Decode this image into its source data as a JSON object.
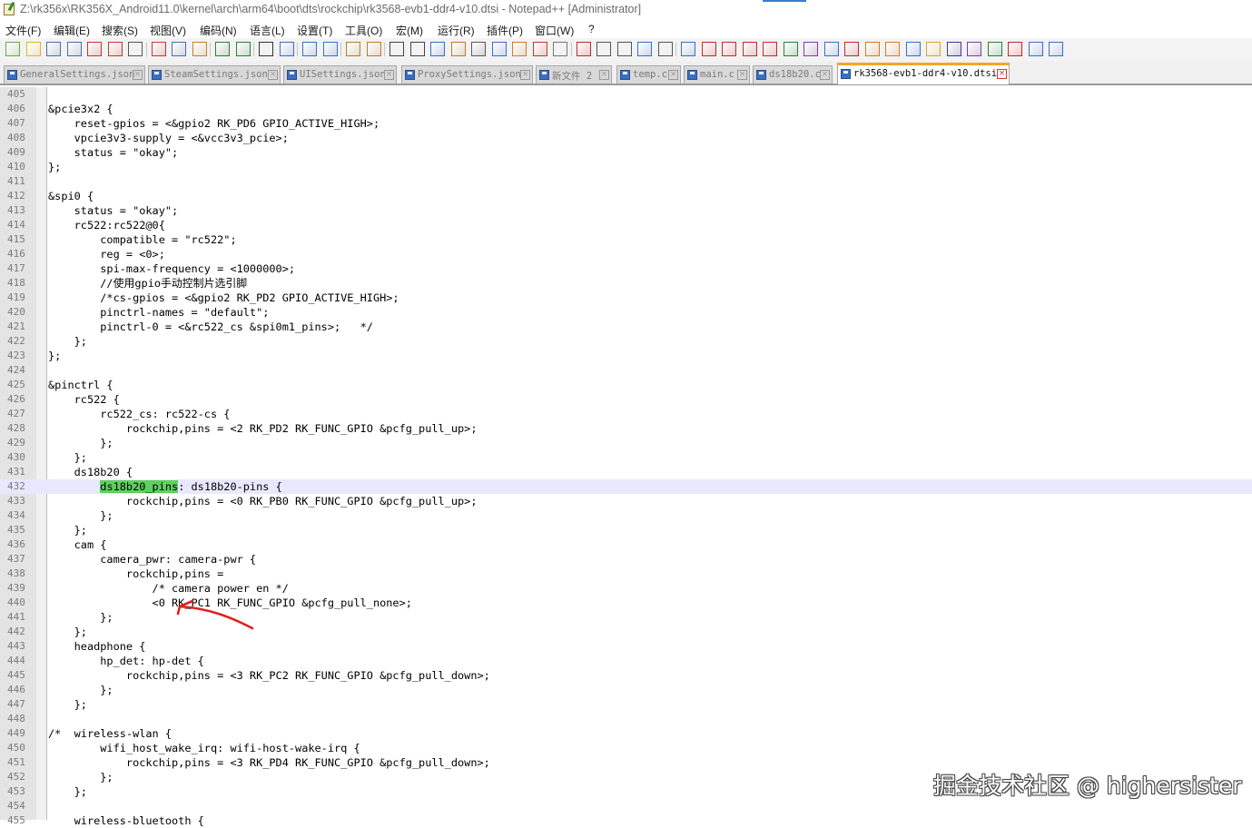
{
  "window": {
    "title": "Z:\\rk356x\\RK356X_Android11.0\\kernel\\arch\\arm64\\boot\\dts\\rockchip\\rk3568-evb1-ddr4-v10.dtsi - Notepad++ [Administrator]"
  },
  "menu": [
    "文件(F)",
    "编辑(E)",
    "搜索(S)",
    "视图(V)",
    "编码(N)",
    "语言(L)",
    "设置(T)",
    "工具(O)",
    "宏(M)",
    "运行(R)",
    "插件(P)",
    "窗口(W)",
    "?"
  ],
  "toolbar": {
    "icons": [
      "new-file-icon",
      "open-file-icon",
      "save-icon",
      "save-all-icon",
      "close-icon",
      "close-all-icon",
      "print-icon",
      "cut-icon",
      "copy-icon",
      "paste-icon",
      "undo-icon",
      "redo-icon",
      "find-icon",
      "replace-icon",
      "zoom-in-icon",
      "zoom-out-icon",
      "sync-vertical-icon",
      "sync-horizontal-icon",
      "word-wrap-icon",
      "show-all-chars-icon",
      "indent-guide-icon",
      "lang-udl-icon",
      "doc-map-icon",
      "doc-list-icon",
      "function-list-icon",
      "folder-workspace-icon",
      "monitoring-icon",
      "record-macro-icon",
      "stop-record-icon",
      "play-macro-icon",
      "run-macro-multiple-icon",
      "save-macro-icon",
      "prev-bookmark-icon",
      "jump-first-icon",
      "jump-prev-icon",
      "jump-next-icon",
      "jump-last-icon",
      "plugin-a-icon",
      "plugin-b-icon",
      "plugin-c-icon",
      "plugin-d-icon",
      "plugin-e-icon",
      "plugin-f-icon",
      "plugin-g-icon",
      "plugin-h-icon",
      "plugin-i-icon",
      "plugin-j-icon",
      "plugin-k-icon",
      "plugin-l-icon",
      "plugin-m-icon",
      "plugin-n-icon"
    ]
  },
  "tabs": [
    {
      "label": "GeneralSettings.json",
      "active": false
    },
    {
      "label": "SteamSettings.json",
      "active": false
    },
    {
      "label": "UISettings.json",
      "active": false
    },
    {
      "label": "ProxySettings.json",
      "active": false
    },
    {
      "label": "新文件 2",
      "active": false
    },
    {
      "label": "temp.c",
      "active": false
    },
    {
      "label": "main.c",
      "active": false
    },
    {
      "label": "ds18b20.c",
      "active": false
    },
    {
      "label": "rk3568-evb1-ddr4-v10.dtsi",
      "active": true
    }
  ],
  "editor": {
    "current_line": 432,
    "highlight_term": "ds18b20_pins",
    "lines": [
      {
        "n": "405",
        "text": ""
      },
      {
        "n": "406",
        "text": "&pcie3x2 {"
      },
      {
        "n": "407",
        "text": "    reset-gpios = <&gpio2 RK_PD6 GPIO_ACTIVE_HIGH>;"
      },
      {
        "n": "408",
        "text": "    vpcie3v3-supply = <&vcc3v3_pcie>;"
      },
      {
        "n": "409",
        "text": "    status = \"okay\";"
      },
      {
        "n": "410",
        "text": "};"
      },
      {
        "n": "411",
        "text": ""
      },
      {
        "n": "412",
        "text": "&spi0 {"
      },
      {
        "n": "413",
        "text": "    status = \"okay\";"
      },
      {
        "n": "414",
        "text": "    rc522:rc522@0{"
      },
      {
        "n": "415",
        "text": "        compatible = \"rc522\";"
      },
      {
        "n": "416",
        "text": "        reg = <0>;"
      },
      {
        "n": "417",
        "text": "        spi-max-frequency = <1000000>;"
      },
      {
        "n": "418",
        "text": "        //使用gpio手动控制片选引脚"
      },
      {
        "n": "419",
        "text": "        /*cs-gpios = <&gpio2 RK_PD2 GPIO_ACTIVE_HIGH>;"
      },
      {
        "n": "420",
        "text": "        pinctrl-names = \"default\";"
      },
      {
        "n": "421",
        "text": "        pinctrl-0 = <&rc522_cs &spi0m1_pins>;   */"
      },
      {
        "n": "422",
        "text": "    };"
      },
      {
        "n": "423",
        "text": "};"
      },
      {
        "n": "424",
        "text": ""
      },
      {
        "n": "425",
        "text": "&pinctrl {"
      },
      {
        "n": "426",
        "text": "    rc522 {"
      },
      {
        "n": "427",
        "text": "        rc522_cs: rc522-cs {"
      },
      {
        "n": "428",
        "text": "            rockchip,pins = <2 RK_PD2 RK_FUNC_GPIO &pcfg_pull_up>;"
      },
      {
        "n": "429",
        "text": "        };"
      },
      {
        "n": "430",
        "text": "    };"
      },
      {
        "n": "431",
        "text": "    ds18b20 {"
      },
      {
        "n": "432",
        "text": "        ds18b20_pins: ds18b20-pins {"
      },
      {
        "n": "433",
        "text": "            rockchip,pins = <0 RK_PB0 RK_FUNC_GPIO &pcfg_pull_up>;"
      },
      {
        "n": "434",
        "text": "        };"
      },
      {
        "n": "435",
        "text": "    };"
      },
      {
        "n": "436",
        "text": "    cam {"
      },
      {
        "n": "437",
        "text": "        camera_pwr: camera-pwr {"
      },
      {
        "n": "438",
        "text": "            rockchip,pins ="
      },
      {
        "n": "439",
        "text": "                /* camera power en */"
      },
      {
        "n": "440",
        "text": "                <0 RK_PC1 RK_FUNC_GPIO &pcfg_pull_none>;"
      },
      {
        "n": "441",
        "text": "        };"
      },
      {
        "n": "442",
        "text": "    };"
      },
      {
        "n": "443",
        "text": "    headphone {"
      },
      {
        "n": "444",
        "text": "        hp_det: hp-det {"
      },
      {
        "n": "445",
        "text": "            rockchip,pins = <3 RK_PC2 RK_FUNC_GPIO &pcfg_pull_down>;"
      },
      {
        "n": "446",
        "text": "        };"
      },
      {
        "n": "447",
        "text": "    };"
      },
      {
        "n": "448",
        "text": ""
      },
      {
        "n": "449",
        "text": "/*  wireless-wlan {"
      },
      {
        "n": "450",
        "text": "        wifi_host_wake_irq: wifi-host-wake-irq {"
      },
      {
        "n": "451",
        "text": "            rockchip,pins = <3 RK_PD4 RK_FUNC_GPIO &pcfg_pull_down>;"
      },
      {
        "n": "452",
        "text": "        };"
      },
      {
        "n": "453",
        "text": "    };"
      },
      {
        "n": "454",
        "text": ""
      },
      {
        "n": "455",
        "text": "    wireless-bluetooth {"
      }
    ]
  },
  "watermark": "掘金技术社区 @ highersister",
  "colors": {
    "highlight": "#5fcf5f",
    "current_line": "#e8e8ff",
    "arrow": "#e02020",
    "active_tab_accent": "#f5a623"
  }
}
